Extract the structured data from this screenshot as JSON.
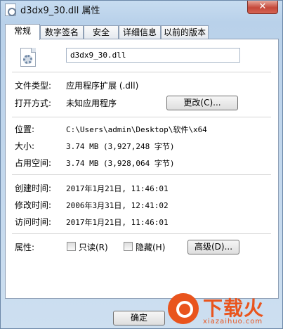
{
  "window": {
    "title": "d3dx9_30.dll 属性",
    "close_glyph": "✕"
  },
  "tabs": [
    {
      "label": "常规",
      "active": true
    },
    {
      "label": "数字签名",
      "active": false
    },
    {
      "label": "安全",
      "active": false
    },
    {
      "label": "详细信息",
      "active": false
    },
    {
      "label": "以前的版本",
      "active": false
    }
  ],
  "general": {
    "file_name": "d3dx9_30.dll",
    "file_type_label": "文件类型:",
    "file_type_value": "应用程序扩展 (.dll)",
    "open_with_label": "打开方式:",
    "open_with_value": "未知应用程序",
    "change_button": "更改(C)...",
    "location_label": "位置:",
    "location_value": "C:\\Users\\admin\\Desktop\\软件\\x64",
    "size_label": "大小:",
    "size_value": "3.74 MB (3,927,248 字节)",
    "size_on_disk_label": "占用空间:",
    "size_on_disk_value": "3.74 MB (3,928,064 字节)",
    "created_label": "创建时间:",
    "created_value": "2017年1月21日, 11:46:01",
    "modified_label": "修改时间:",
    "modified_value": "2006年3月31日, 12:41:02",
    "accessed_label": "访问时间:",
    "accessed_value": "2017年1月21日, 11:46:01",
    "attributes_label": "属性:",
    "readonly_label": "只读(R)",
    "readonly_checked": false,
    "hidden_label": "隐藏(H)",
    "hidden_checked": false,
    "advanced_button": "高级(D)..."
  },
  "footer": {
    "ok_button": "确定"
  },
  "watermark": {
    "brand": "下载火",
    "url": "xiazaihuo.com",
    "color": "#e9541d"
  }
}
